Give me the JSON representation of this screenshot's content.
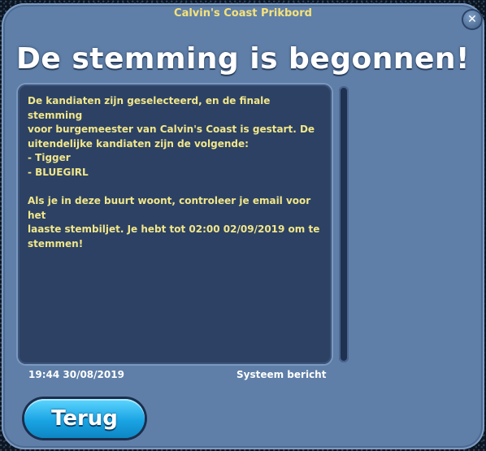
{
  "window": {
    "title": "Calvin's Coast Prikbord",
    "close_icon": "close-icon"
  },
  "post": {
    "headline": "De stemming is begonnen!",
    "body": "De kandiaten zijn geselecteerd, en de finale stemming\nvoor burgemeester van Calvin's Coast is gestart. De\nuitendelijke kandiaten zijn de volgende:\n- Tigger\n- BLUEGIRL\n\nAls je in deze buurt woont, controleer je email voor het\nlaaste stembiljet. Je hebt tot 02:00 02/09/2019 om te\nstemmen!",
    "timestamp": "19:44 30/08/2019",
    "sender": "Systeem bericht"
  },
  "actions": {
    "back_label": "Terug"
  },
  "colors": {
    "window_bg": "#5f7fa8",
    "panel_bg": "#2c4163",
    "body_text": "#f1e68a",
    "title_text": "#f6e27a",
    "button_accent": "#1aa4e4"
  }
}
